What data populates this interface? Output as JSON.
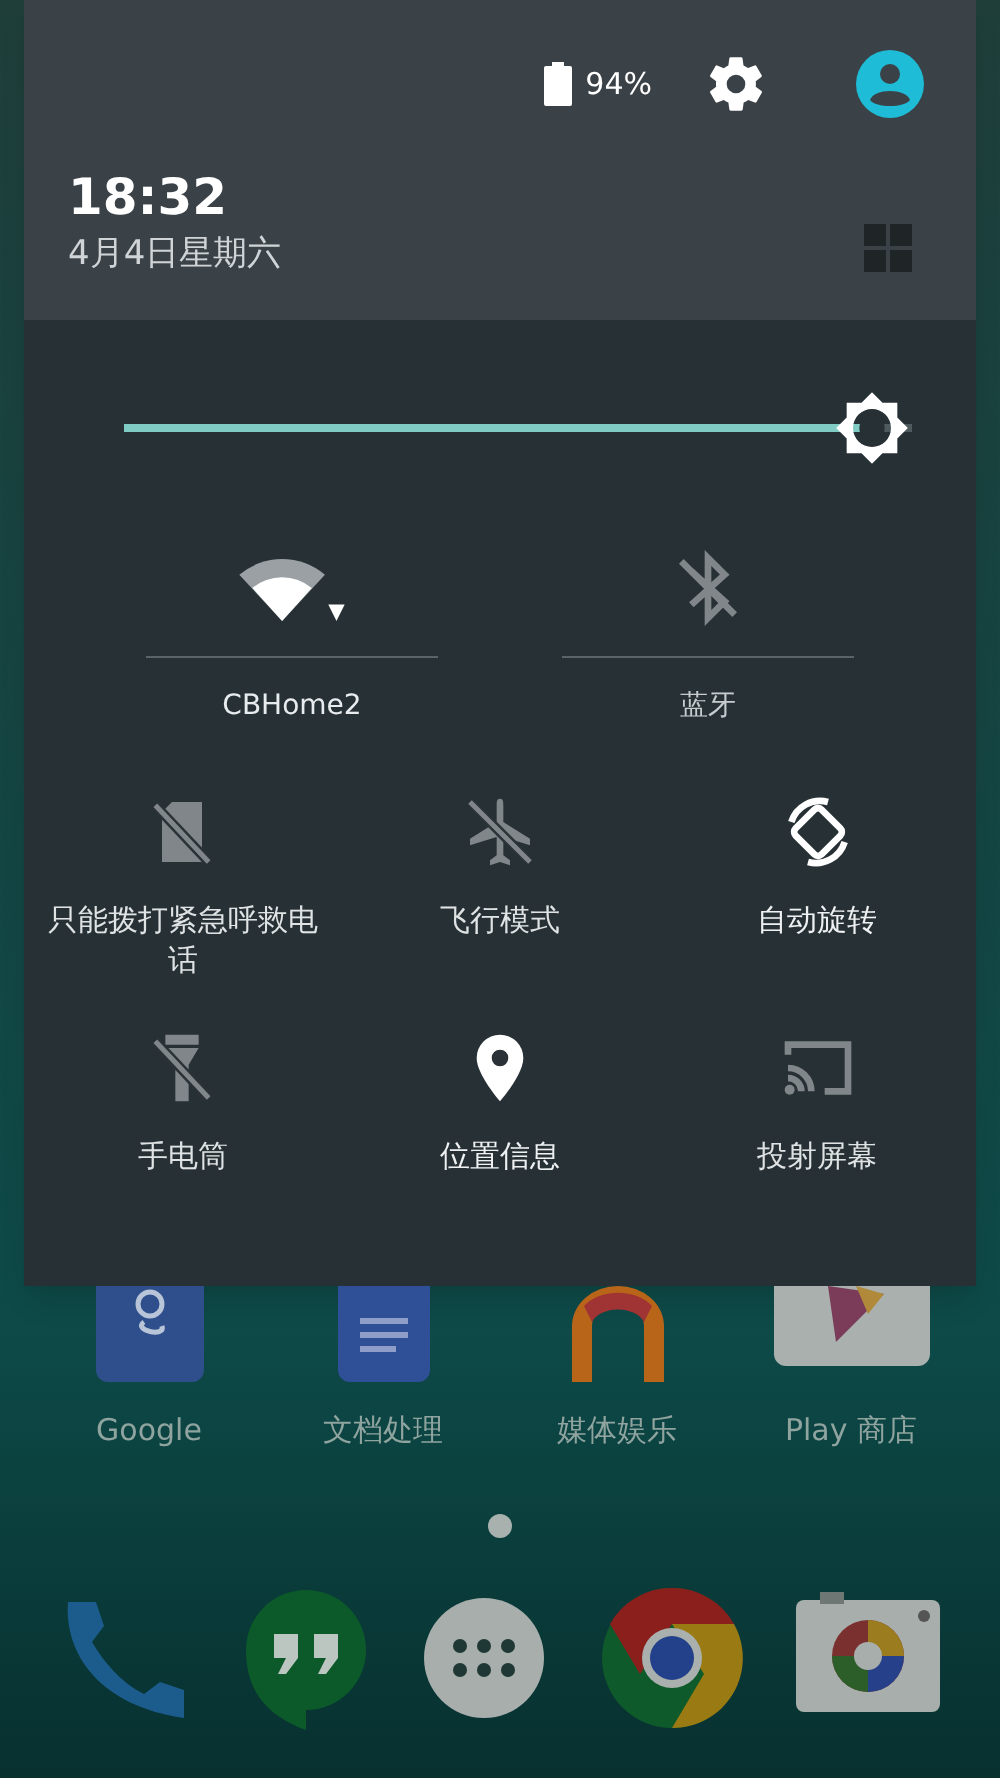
{
  "header": {
    "battery": "94%",
    "time": "18:32",
    "date": "4月4日星期六"
  },
  "brightness": {
    "level": 0.95
  },
  "big_tiles": [
    {
      "kind": "wifi",
      "label": "CBHome2",
      "on": true
    },
    {
      "kind": "bluetooth",
      "label": "蓝牙",
      "on": false
    }
  ],
  "tiles": [
    {
      "kind": "sim",
      "label": "只能拨打紧急呼救电话",
      "on": false
    },
    {
      "kind": "airplane",
      "label": "飞行模式",
      "on": false
    },
    {
      "kind": "rotate",
      "label": "自动旋转",
      "on": true
    },
    {
      "kind": "flashlight",
      "label": "手电筒",
      "on": false
    },
    {
      "kind": "location",
      "label": "位置信息",
      "on": true
    },
    {
      "kind": "cast",
      "label": "投射屏幕",
      "on": false
    }
  ],
  "home_apps": [
    {
      "kind": "google",
      "label": "Google"
    },
    {
      "kind": "docs",
      "label": "文档处理"
    },
    {
      "kind": "media",
      "label": "媒体娱乐"
    },
    {
      "kind": "play",
      "label": "Play 商店"
    }
  ],
  "dock": [
    {
      "kind": "phone"
    },
    {
      "kind": "hangouts"
    },
    {
      "kind": "drawer"
    },
    {
      "kind": "chrome"
    },
    {
      "kind": "camera"
    }
  ]
}
